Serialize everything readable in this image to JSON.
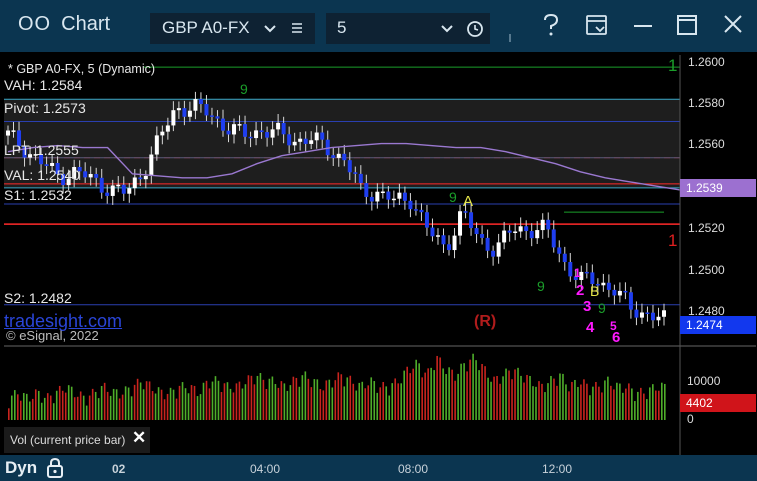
{
  "titlebar": {
    "app_icon_text": "OO",
    "title": "Chart",
    "symbol": "GBP A0-FX",
    "interval": "5",
    "colors": {
      "bg": "#0b3550",
      "field": "#0e2233"
    }
  },
  "chart": {
    "header": "* GBP A0-FX, 5 (Dynamic)",
    "brand": "tradesight.com",
    "copyright": "© eSignal, 2022",
    "annotation_R": "(R)",
    "price_axis_ticks": [
      "1.2600",
      "1.2580",
      "1.2560",
      "1.2540",
      "1.2520",
      "1.2500",
      "1.2480"
    ],
    "current_price": "1.2474",
    "badge_1": "1.2539",
    "volume_axis_ticks": [
      "10000",
      "0"
    ],
    "current_volume": "4402",
    "levels": [
      {
        "label": "VAH: 1.2584",
        "name": "vah"
      },
      {
        "label": "Pivot: 1.2573",
        "name": "pivot"
      },
      {
        "label": "LPT: 1.2555",
        "name": "lpt"
      },
      {
        "label": "VAL: 1.2540",
        "name": "val"
      },
      {
        "label": "S1: 1.2532",
        "name": "s1"
      },
      {
        "label": "S2: 1.2482",
        "name": "s2"
      }
    ],
    "level_right_labels": [
      "1",
      "1"
    ],
    "marker_A": "A",
    "marker_B": "B",
    "magenta_counts": [
      "1",
      "2",
      "3",
      "4",
      "5",
      "6"
    ],
    "green_counts": [
      "9",
      "9",
      "9",
      "9",
      "9"
    ]
  },
  "volume_label": "Vol (current price bar)",
  "bottombar": {
    "dyn": "Dyn",
    "time_labels": [
      "02",
      "04:00",
      "08:00",
      "12:00"
    ]
  },
  "chart_data": {
    "type": "candlestick",
    "symbol": "GBP A0-FX",
    "interval": "5",
    "x_ticks": [
      "02",
      "04:00",
      "08:00",
      "12:00"
    ],
    "y_ticks": [
      1.26,
      1.258,
      1.256,
      1.254,
      1.252,
      1.25,
      1.248
    ],
    "ylim": [
      1.2462,
      1.2606
    ],
    "close_path": [
      1.2566,
      1.256,
      1.2552,
      1.2546,
      1.2548,
      1.2544,
      1.254,
      1.2537,
      1.2548,
      1.2564,
      1.258,
      1.258,
      1.2577,
      1.257,
      1.2566,
      1.2569,
      1.2567,
      1.2564,
      1.2564,
      1.256,
      1.2554,
      1.2538,
      1.2538,
      1.2533,
      1.2535,
      1.2518,
      1.251,
      1.2528,
      1.2514,
      1.251,
      1.2519,
      1.252,
      1.2519,
      1.2504,
      1.2494,
      1.2494,
      1.249,
      1.248,
      1.2478,
      1.2474
    ],
    "moving_average": [
      1.2558,
      1.256,
      1.2561,
      1.256,
      1.256,
      1.2547,
      1.2546,
      1.2545,
      1.2545,
      1.2547,
      1.2552,
      1.2556,
      1.2558,
      1.256,
      1.2561,
      1.2562,
      1.2562,
      1.2561,
      1.256,
      1.256,
      1.2558,
      1.2555,
      1.2552,
      1.2548,
      1.2545,
      1.2543,
      1.2541,
      1.2539
    ],
    "levels": {
      "VAH": 1.2584,
      "Pivot": 1.2573,
      "LPT": 1.2555,
      "VAL": 1.254,
      "S1": 1.2532,
      "S2": 1.2482
    },
    "current_price": 1.2474,
    "volume_ticks": [
      10000,
      0
    ],
    "current_volume": 4402,
    "volume_profile": [
      2,
      3,
      2,
      3,
      2,
      3,
      4,
      3,
      2,
      3,
      4,
      3,
      3,
      4,
      5,
      4,
      3,
      3,
      4,
      4,
      3,
      5,
      5,
      4,
      4,
      5,
      6,
      5,
      5,
      4,
      5,
      6,
      5,
      4,
      5,
      6,
      5,
      4,
      5,
      4,
      4,
      5,
      7,
      8,
      6,
      9,
      7,
      6,
      8,
      9,
      7,
      5,
      6,
      7,
      6,
      5,
      4,
      5,
      6,
      4,
      5,
      4,
      4,
      5,
      4,
      4,
      3,
      3,
      4,
      4
    ]
  }
}
